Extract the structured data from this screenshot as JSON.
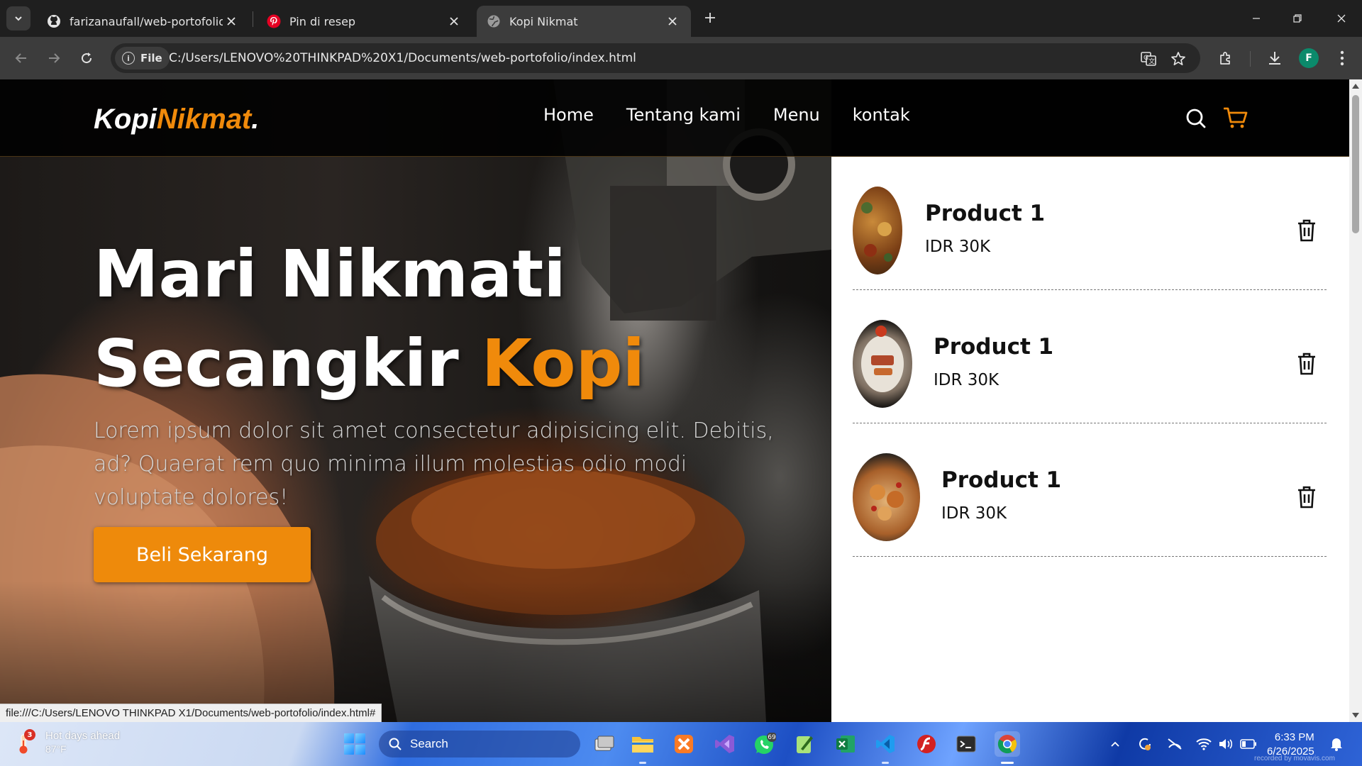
{
  "browser": {
    "tabs": [
      {
        "title": "farizanaufall/web-portofolio",
        "favicon": "github-icon",
        "active": false
      },
      {
        "title": "Pin di resep",
        "favicon": "pinterest-icon",
        "active": false
      },
      {
        "title": "Kopi Nikmat",
        "favicon": "globe-icon",
        "active": true
      }
    ],
    "address": {
      "scheme_chip": "File",
      "url": "C:/Users/LENOVO%20THINKPAD%20X1/Documents/web-portofolio/index.html"
    },
    "profile_initial": "F",
    "status_url": "file:///C:/Users/LENOVO THINKPAD X1/Documents/web-portofolio/index.html#"
  },
  "page": {
    "logo": {
      "part1": "Kopi",
      "part2": "Nikmat",
      "part3": "."
    },
    "nav": [
      "Home",
      "Tentang kami",
      "Menu",
      "kontak"
    ],
    "hero": {
      "line1": "Mari Nikmati",
      "line2_white": "Secangkir",
      "line2_accent": "Kopi",
      "text": "Lorem ipsum dolor sit amet consectetur adipisicing elit. Debitis, ad? Quaerat rem quo minima illum molestias odio modi voluptate dolores!",
      "cta": "Beli Sekarang"
    },
    "cart": [
      {
        "name": "Product 1",
        "price": "IDR 30K"
      },
      {
        "name": "Product 1",
        "price": "IDR 30K"
      },
      {
        "name": "Product 1",
        "price": "IDR 30K"
      }
    ],
    "accent_color": "#f08a0b"
  },
  "taskbar": {
    "weather": {
      "title": "Hot days ahead",
      "temp": "87°F",
      "badge": "3"
    },
    "search_label": "Search",
    "whatsapp_badge": "69",
    "time": "6:33 PM",
    "date": "6/26/2025",
    "watermark": "recorded by movavis.com"
  }
}
